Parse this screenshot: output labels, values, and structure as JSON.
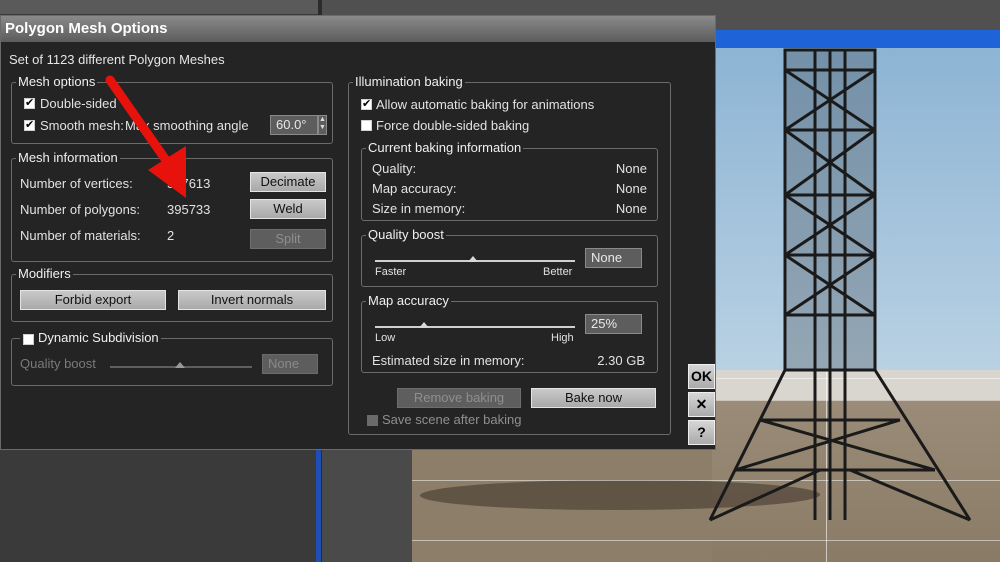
{
  "dialog": {
    "title": "Polygon Mesh Options",
    "subtitle": "Set of 1123 different Polygon Meshes"
  },
  "mesh_options": {
    "title": "Mesh options",
    "double_sided_label": "Double-sided",
    "double_sided_checked": true,
    "smooth_mesh_label": "Smooth mesh:",
    "smooth_mesh_checked": true,
    "smoothing_angle_label": "Max smoothing angle",
    "smoothing_angle_value": "60.0°"
  },
  "mesh_information": {
    "title": "Mesh information",
    "vertices_label": "Number of vertices:",
    "vertices_value": "547613",
    "polygons_label": "Number of polygons:",
    "polygons_value": "395733",
    "materials_label": "Number of materials:",
    "materials_value": "2",
    "decimate_label": "Decimate",
    "weld_label": "Weld",
    "split_label": "Split"
  },
  "modifiers": {
    "title": "Modifiers",
    "forbid_export_label": "Forbid export",
    "invert_normals_label": "Invert normals"
  },
  "dynamic_subdivision": {
    "label": "Dynamic Subdivision",
    "checked": false,
    "quality_boost_label": "Quality boost",
    "quality_boost_value": "None"
  },
  "illumination_baking": {
    "title": "Illumination baking",
    "auto_baking_label": "Allow automatic baking for animations",
    "auto_baking_checked": true,
    "force_double_sided_label": "Force double-sided baking",
    "force_double_sided_checked": false,
    "current_info": {
      "title": "Current baking information",
      "quality_label": "Quality:",
      "quality_value": "None",
      "map_accuracy_label": "Map accuracy:",
      "map_accuracy_value": "None",
      "size_label": "Size in memory:",
      "size_value": "None"
    },
    "quality_boost": {
      "title": "Quality boost",
      "min_label": "Faster",
      "max_label": "Better",
      "value": "None"
    },
    "map_accuracy": {
      "title": "Map accuracy",
      "min_label": "Low",
      "max_label": "High",
      "value": "25%",
      "estimated_label": "Estimated size in memory:",
      "estimated_value": "2.30 GB"
    },
    "remove_baking_label": "Remove baking",
    "bake_now_label": "Bake now",
    "save_scene_label": "Save scene after baking"
  },
  "side_buttons": {
    "ok_label": "OK",
    "close_label": "✕",
    "help_label": "?"
  },
  "colors": {
    "dialog_bg": "#242424",
    "annotation_arrow": "#e8120c",
    "viewport_blue": "#1e63d8"
  }
}
